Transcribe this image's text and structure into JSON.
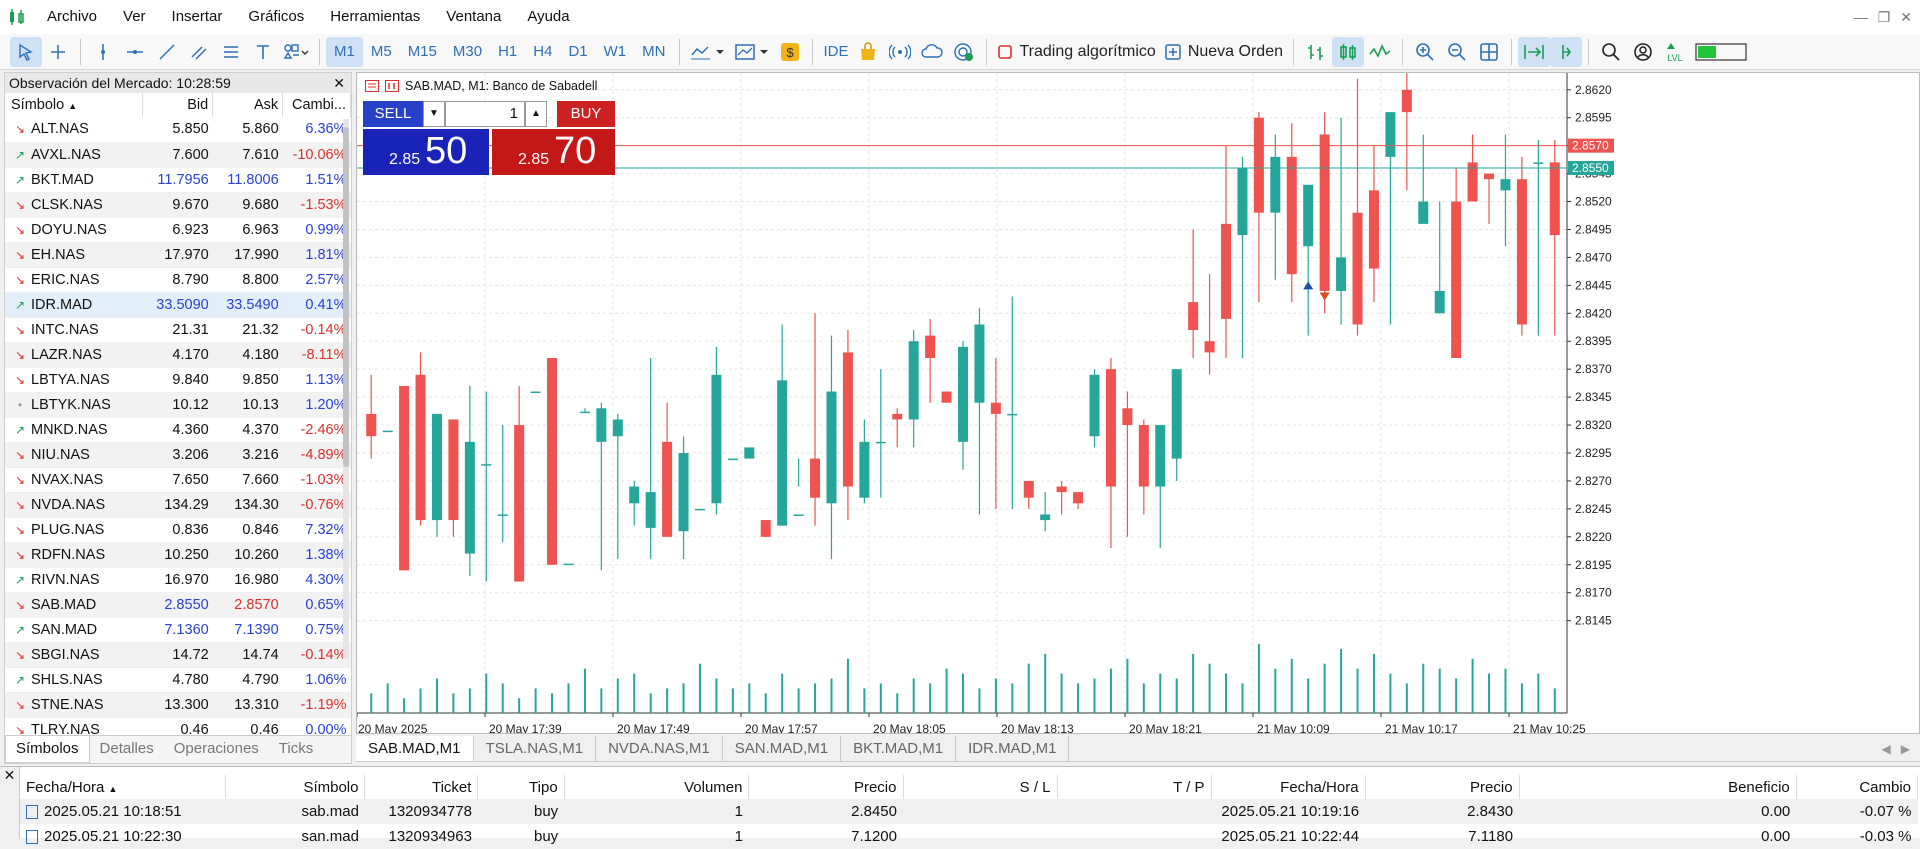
{
  "menu": [
    "Archivo",
    "Ver",
    "Insertar",
    "Gráficos",
    "Herramientas",
    "Ventana",
    "Ayuda"
  ],
  "toolbar": {
    "timeframes": [
      "M1",
      "M5",
      "M15",
      "M30",
      "H1",
      "H4",
      "D1",
      "W1",
      "MN"
    ],
    "active_timeframe": "M1",
    "ide_label": "IDE",
    "algo_label": "Trading algorítmico",
    "new_order_label": "Nueva Orden",
    "level_label": "LVL"
  },
  "market_watch": {
    "title": "Observación del Mercado: 10:28:59",
    "columns": [
      "Símbolo",
      "Bid",
      "Ask",
      "Cambi..."
    ],
    "rows": [
      {
        "symbol": "ALT.NAS",
        "bid": "5.850",
        "ask": "5.860",
        "change": "6.36%",
        "dir": "down",
        "chg_color": "blue",
        "price_color": "",
        "sel": false
      },
      {
        "symbol": "AVXL.NAS",
        "bid": "7.600",
        "ask": "7.610",
        "change": "-10.06%",
        "dir": "up",
        "chg_color": "red",
        "price_color": "",
        "sel": false
      },
      {
        "symbol": "BKT.MAD",
        "bid": "11.7956",
        "ask": "11.8006",
        "change": "1.51%",
        "dir": "up",
        "chg_color": "blue",
        "price_color": "blue",
        "sel": false
      },
      {
        "symbol": "CLSK.NAS",
        "bid": "9.670",
        "ask": "9.680",
        "change": "-1.53%",
        "dir": "down",
        "chg_color": "red",
        "price_color": "",
        "sel": false
      },
      {
        "symbol": "DOYU.NAS",
        "bid": "6.923",
        "ask": "6.963",
        "change": "0.99%",
        "dir": "down",
        "chg_color": "blue",
        "price_color": "",
        "sel": false
      },
      {
        "symbol": "EH.NAS",
        "bid": "17.970",
        "ask": "17.990",
        "change": "1.81%",
        "dir": "down",
        "chg_color": "blue",
        "price_color": "",
        "sel": false
      },
      {
        "symbol": "ERIC.NAS",
        "bid": "8.790",
        "ask": "8.800",
        "change": "2.57%",
        "dir": "down",
        "chg_color": "blue",
        "price_color": "",
        "sel": false
      },
      {
        "symbol": "IDR.MAD",
        "bid": "33.5090",
        "ask": "33.5490",
        "change": "0.41%",
        "dir": "up",
        "chg_color": "blue",
        "price_color": "blue",
        "sel": true
      },
      {
        "symbol": "INTC.NAS",
        "bid": "21.31",
        "ask": "21.32",
        "change": "-0.14%",
        "dir": "down",
        "chg_color": "red",
        "price_color": "",
        "sel": false
      },
      {
        "symbol": "LAZR.NAS",
        "bid": "4.170",
        "ask": "4.180",
        "change": "-8.11%",
        "dir": "down",
        "chg_color": "red",
        "price_color": "",
        "sel": false
      },
      {
        "symbol": "LBTYA.NAS",
        "bid": "9.840",
        "ask": "9.850",
        "change": "1.13%",
        "dir": "down",
        "chg_color": "blue",
        "price_color": "",
        "sel": false
      },
      {
        "symbol": "LBTYK.NAS",
        "bid": "10.12",
        "ask": "10.13",
        "change": "1.20%",
        "dir": "dot",
        "chg_color": "blue",
        "price_color": "",
        "sel": false
      },
      {
        "symbol": "MNKD.NAS",
        "bid": "4.360",
        "ask": "4.370",
        "change": "-2.46%",
        "dir": "up",
        "chg_color": "red",
        "price_color": "",
        "sel": false
      },
      {
        "symbol": "NIU.NAS",
        "bid": "3.206",
        "ask": "3.216",
        "change": "-4.89%",
        "dir": "down",
        "chg_color": "red",
        "price_color": "",
        "sel": false
      },
      {
        "symbol": "NVAX.NAS",
        "bid": "7.650",
        "ask": "7.660",
        "change": "-1.03%",
        "dir": "down",
        "chg_color": "red",
        "price_color": "",
        "sel": false
      },
      {
        "symbol": "NVDA.NAS",
        "bid": "134.29",
        "ask": "134.30",
        "change": "-0.76%",
        "dir": "down",
        "chg_color": "red",
        "price_color": "",
        "sel": false
      },
      {
        "symbol": "PLUG.NAS",
        "bid": "0.836",
        "ask": "0.846",
        "change": "7.32%",
        "dir": "down",
        "chg_color": "blue",
        "price_color": "",
        "sel": false
      },
      {
        "symbol": "RDFN.NAS",
        "bid": "10.250",
        "ask": "10.260",
        "change": "1.38%",
        "dir": "down",
        "chg_color": "blue",
        "price_color": "",
        "sel": false
      },
      {
        "symbol": "RIVN.NAS",
        "bid": "16.970",
        "ask": "16.980",
        "change": "4.30%",
        "dir": "up",
        "chg_color": "blue",
        "price_color": "",
        "sel": false
      },
      {
        "symbol": "SAB.MAD",
        "bid": "2.8550",
        "ask": "2.8570",
        "change": "0.65%",
        "dir": "down",
        "chg_color": "blue",
        "price_color": "blue-red",
        "sel": false
      },
      {
        "symbol": "SAN.MAD",
        "bid": "7.1360",
        "ask": "7.1390",
        "change": "0.75%",
        "dir": "up",
        "chg_color": "blue",
        "price_color": "blue",
        "sel": false
      },
      {
        "symbol": "SBGI.NAS",
        "bid": "14.72",
        "ask": "14.74",
        "change": "-0.14%",
        "dir": "down",
        "chg_color": "red",
        "price_color": "",
        "sel": false
      },
      {
        "symbol": "SHLS.NAS",
        "bid": "4.780",
        "ask": "4.790",
        "change": "1.06%",
        "dir": "up",
        "chg_color": "blue",
        "price_color": "",
        "sel": false
      },
      {
        "symbol": "STNE.NAS",
        "bid": "13.300",
        "ask": "13.310",
        "change": "-1.19%",
        "dir": "down",
        "chg_color": "red",
        "price_color": "",
        "sel": false
      },
      {
        "symbol": "TLRY.NAS",
        "bid": "0.46",
        "ask": "0.46",
        "change": "0.00%",
        "dir": "down",
        "chg_color": "blue",
        "price_color": "",
        "sel": false
      }
    ],
    "tabs": [
      "Símbolos",
      "Detalles",
      "Operaciones",
      "Ticks"
    ],
    "active_tab": "Símbolos"
  },
  "chart": {
    "header": "SAB.MAD, M1:  Banco de Sabadell",
    "sell_label": "SELL",
    "buy_label": "BUY",
    "lot": "1",
    "sell_price_small": "2.85",
    "sell_price_big": "50",
    "buy_price_small": "2.85",
    "buy_price_big": "70",
    "colors": {
      "bull": "#26a69a",
      "bear": "#ef5350",
      "ask_line": "#ef5350",
      "bid_line": "#26a69a",
      "grid": "#e6e6e6"
    }
  },
  "chart_data": {
    "type": "candlestick",
    "symbol": "SAB.MAD",
    "timeframe": "M1",
    "y_ticks": [
      "2.8620",
      "2.8595",
      "2.8570",
      "2.8545",
      "2.8520",
      "2.8495",
      "2.8470",
      "2.8445",
      "2.8420",
      "2.8395",
      "2.8370",
      "2.8345",
      "2.8320",
      "2.8295",
      "2.8270",
      "2.8245",
      "2.8220",
      "2.8195",
      "2.8170",
      "2.8145"
    ],
    "ylim": [
      2.8125,
      2.8635
    ],
    "x_labels": [
      "20 May 2025",
      "20 May 17:39",
      "20 May 17:49",
      "20 May 17:57",
      "20 May 18:05",
      "20 May 18:13",
      "20 May 18:21",
      "21 May 10:09",
      "21 May 10:17",
      "21 May 10:25"
    ],
    "ask_price": "2.8570",
    "bid_price": "2.8550",
    "ohlc": [
      [
        2.833,
        2.8365,
        2.829,
        2.831
      ],
      [
        2.8315,
        2.8315,
        2.8315,
        2.8315
      ],
      [
        2.8355,
        2.8355,
        2.819,
        2.819
      ],
      [
        2.8365,
        2.8385,
        2.823,
        2.8235
      ],
      [
        2.8235,
        2.833,
        2.822,
        2.833
      ],
      [
        2.8325,
        2.8325,
        2.822,
        2.8235
      ],
      [
        2.8205,
        2.8355,
        2.8185,
        2.8305
      ],
      [
        2.8285,
        2.835,
        2.818,
        2.8285
      ],
      [
        2.824,
        2.832,
        2.8215,
        2.824
      ],
      [
        2.832,
        2.8355,
        2.818,
        2.818
      ],
      [
        2.835,
        2.835,
        2.835,
        2.835
      ],
      [
        2.838,
        2.838,
        2.8195,
        2.8195
      ],
      [
        2.8196,
        2.8196,
        2.8196,
        2.8196
      ],
      [
        2.8332,
        2.8335,
        2.8332,
        2.8332
      ],
      [
        2.8305,
        2.834,
        2.819,
        2.8335
      ],
      [
        2.831,
        2.833,
        2.82,
        2.8325
      ],
      [
        2.825,
        2.827,
        2.823,
        2.8265
      ],
      [
        2.8228,
        2.838,
        2.82,
        2.826
      ],
      [
        2.8305,
        2.834,
        2.826,
        2.822
      ],
      [
        2.8225,
        2.831,
        2.82,
        2.8295
      ],
      [
        2.8245,
        2.8245,
        2.8245,
        2.8245
      ],
      [
        2.825,
        2.839,
        2.824,
        2.8365
      ],
      [
        2.829,
        2.829,
        2.829,
        2.829
      ],
      [
        2.829,
        2.83,
        2.83,
        2.83
      ],
      [
        2.8235,
        2.8235,
        2.822,
        2.822
      ],
      [
        2.823,
        2.841,
        2.823,
        2.836
      ],
      [
        2.824,
        2.8265,
        2.829,
        2.824
      ],
      [
        2.829,
        2.842,
        2.823,
        2.8255
      ],
      [
        2.825,
        2.84,
        2.82,
        2.835
      ],
      [
        2.8385,
        2.8405,
        2.8235,
        2.8265
      ],
      [
        2.8255,
        2.8325,
        2.825,
        2.8305
      ],
      [
        2.8305,
        2.837,
        2.8255,
        2.8305
      ],
      [
        2.833,
        2.8335,
        2.83,
        2.8325
      ],
      [
        2.8325,
        2.8405,
        2.83,
        2.8395
      ],
      [
        2.84,
        2.8415,
        2.834,
        2.838
      ],
      [
        2.835,
        2.835,
        2.834,
        2.834
      ],
      [
        2.8305,
        2.8395,
        2.828,
        2.839
      ],
      [
        2.834,
        2.8425,
        2.824,
        2.841
      ],
      [
        2.834,
        2.838,
        2.8245,
        2.833
      ],
      [
        2.833,
        2.8435,
        2.8245,
        2.833
      ],
      [
        2.827,
        2.827,
        2.8245,
        2.8255
      ],
      [
        2.8235,
        2.826,
        2.8225,
        2.824
      ],
      [
        2.8265,
        2.827,
        2.824,
        2.826
      ],
      [
        2.826,
        2.826,
        2.8245,
        2.825
      ],
      [
        2.831,
        2.837,
        2.83,
        2.8365
      ],
      [
        2.837,
        2.838,
        2.821,
        2.8265
      ],
      [
        2.8335,
        2.835,
        2.822,
        2.832
      ],
      [
        2.832,
        2.8325,
        2.824,
        2.8265
      ],
      [
        2.8265,
        2.83,
        2.821,
        2.832
      ],
      [
        2.829,
        2.837,
        2.827,
        2.837
      ],
      [
        2.843,
        2.8495,
        2.838,
        2.8405
      ],
      [
        2.8395,
        2.8455,
        2.8365,
        2.8385
      ],
      [
        2.85,
        2.857,
        2.838,
        2.8415
      ],
      [
        2.849,
        2.856,
        2.838,
        2.855
      ],
      [
        2.8595,
        2.86,
        2.843,
        2.851
      ],
      [
        2.851,
        2.858,
        2.845,
        2.856
      ],
      [
        2.856,
        2.859,
        2.843,
        2.8455
      ],
      [
        2.848,
        2.851,
        2.84,
        2.8535
      ],
      [
        2.858,
        2.86,
        2.842,
        2.844
      ],
      [
        2.844,
        2.8595,
        2.841,
        2.847
      ],
      [
        2.851,
        2.863,
        2.84,
        2.841
      ],
      [
        2.853,
        2.857,
        2.843,
        2.846
      ],
      [
        2.856,
        2.86,
        2.841,
        2.86
      ],
      [
        2.862,
        2.864,
        2.853,
        2.86
      ],
      [
        2.85,
        2.858,
        2.851,
        2.852
      ],
      [
        2.842,
        2.852,
        2.842,
        2.844
      ],
      [
        2.852,
        2.855,
        2.839,
        2.838
      ],
      [
        2.8555,
        2.858,
        2.852,
        2.852
      ],
      [
        2.8545,
        2.8545,
        2.85,
        2.854
      ],
      [
        2.853,
        2.858,
        2.848,
        2.854
      ],
      [
        2.854,
        2.856,
        2.84,
        2.841
      ],
      [
        2.8555,
        2.8575,
        2.84,
        2.8555
      ],
      [
        2.8555,
        2.8575,
        2.84,
        2.849
      ]
    ],
    "volume": [
      4,
      6,
      3,
      5,
      7,
      4,
      5,
      8,
      6,
      3,
      5,
      4,
      6,
      9,
      5,
      7,
      8,
      4,
      5,
      6,
      10,
      7,
      5,
      6,
      4,
      8,
      5,
      6,
      7,
      11,
      5,
      6,
      4,
      7,
      6,
      9,
      8,
      5,
      7,
      6,
      10,
      12,
      8,
      6,
      7,
      9,
      11,
      6,
      8,
      7,
      12,
      10,
      8,
      6,
      14,
      9,
      11,
      7,
      10,
      13,
      9,
      12,
      8,
      6,
      10,
      9,
      7,
      11,
      8,
      9,
      6,
      8,
      5
    ]
  },
  "chart_tabs": [
    "SAB.MAD,M1",
    "TSLA.NAS,M1",
    "NVDA.NAS,M1",
    "SAN.MAD,M1",
    "BKT.MAD,M1",
    "IDR.MAD,M1"
  ],
  "active_chart_tab": "SAB.MAD,M1",
  "trades": {
    "columns": [
      "Fecha/Hora",
      "Símbolo",
      "Ticket",
      "Tipo",
      "Volumen",
      "Precio",
      "S / L",
      "T / P",
      "Fecha/Hora",
      "Precio",
      "Beneficio",
      "Cambio"
    ],
    "rows": [
      [
        "2025.05.21 10:18:51",
        "sab.mad",
        "1320934778",
        "buy",
        "1",
        "2.8450",
        "",
        "",
        "2025.05.21 10:19:16",
        "2.8430",
        "0.00",
        "-0.07 %"
      ],
      [
        "2025.05.21 10:22:30",
        "san.mad",
        "1320934963",
        "buy",
        "1",
        "7.1200",
        "",
        "",
        "2025.05.21 10:22:44",
        "7.1180",
        "0.00",
        "-0.03 %"
      ]
    ]
  }
}
